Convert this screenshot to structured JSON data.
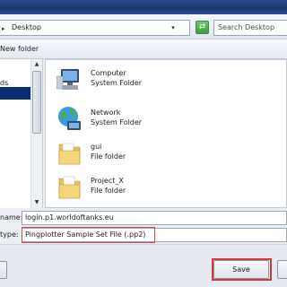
{
  "address_bar": {
    "path": "Desktop",
    "search_placeholder": "Search Desktop"
  },
  "toolbar": {
    "new_folder": "New folder"
  },
  "nav_pane": {
    "items": [
      {
        "label": "ds"
      }
    ]
  },
  "files": [
    {
      "name": "Computer",
      "type": "System Folder",
      "icon": "computer-icon"
    },
    {
      "name": "Network",
      "type": "System Folder",
      "icon": "network-icon"
    },
    {
      "name": "gui",
      "type": "File folder",
      "icon": "folder-icon"
    },
    {
      "name": "Project_X",
      "type": "File folder",
      "icon": "folder-icon"
    }
  ],
  "fields": {
    "filename_label": "name:",
    "filename_value": "login.p1.worldoftanks.eu",
    "filetype_label": "type:",
    "filetype_value": "Pingplotter Sample Set File (.pp2)"
  },
  "buttons": {
    "save": "Save"
  },
  "colors": {
    "highlight": "#d13a3a",
    "title_bar": "#1d3670",
    "nav_selection": "#0b2c70"
  }
}
